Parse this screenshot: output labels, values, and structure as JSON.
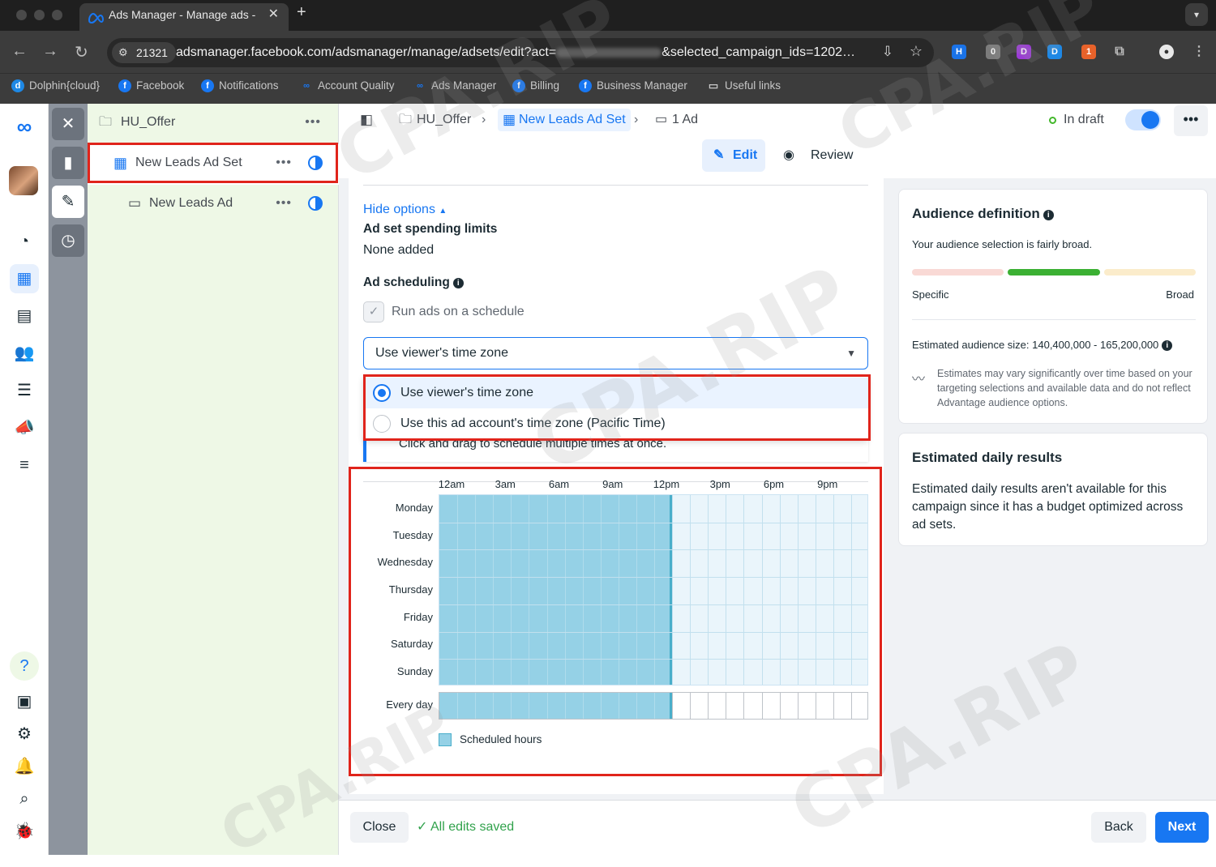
{
  "browser": {
    "tab_title": "Ads Manager - Manage ads -",
    "site_chip": "21321",
    "url_prefix": "adsmanager.facebook.com/adsmanager/manage/adsets/edit?act=",
    "url_suffix": "&selected_campaign_ids=1202…",
    "bookmarks": [
      "Dolphin{cloud}",
      "Facebook",
      "Notifications",
      "Account Quality",
      "Ads Manager",
      "Billing",
      "Business Manager",
      "Useful links"
    ],
    "ext_badges": [
      "0",
      "1"
    ]
  },
  "tree": {
    "campaign": "HU_Offer",
    "adset": "New Leads Ad Set",
    "ad": "New Leads Ad"
  },
  "header": {
    "crumbs": [
      "HU_Offer",
      "New Leads Ad Set",
      "1 Ad"
    ],
    "status": "In draft",
    "edit": "Edit",
    "review": "Review"
  },
  "form": {
    "hide_options": "Hide options",
    "spending_title": "Ad set spending limits",
    "spending_value": "None added",
    "scheduling_title": "Ad scheduling",
    "run_on_schedule": "Run ads on a schedule",
    "timezone_selected": "Use viewer's time zone",
    "timezone_options": [
      "Use viewer's time zone",
      "Use this ad account's time zone (Pacific Time)"
    ],
    "hint": "Click and drag to schedule multiple times at once."
  },
  "schedule": {
    "hour_labels": [
      "12am",
      "3am",
      "6am",
      "9am",
      "12pm",
      "3pm",
      "6pm",
      "9pm"
    ],
    "days": [
      "Monday",
      "Tuesday",
      "Wednesday",
      "Thursday",
      "Friday",
      "Saturday",
      "Sunday"
    ],
    "every_day": "Every day",
    "scheduled_hours_start": 0,
    "scheduled_hours_end": 13,
    "legend": "Scheduled hours",
    "colors": {
      "scheduled": "#95d1e6",
      "edge": "#49aeca"
    }
  },
  "audience": {
    "title": "Audience definition",
    "subtitle": "Your audience selection is fairly broad.",
    "specific": "Specific",
    "broad": "Broad",
    "size": "Estimated audience size: 140,400,000 - 165,200,000",
    "note": "Estimates may vary significantly over time based on your targeting selections and available data and do not reflect Advantage audience options."
  },
  "daily": {
    "title": "Estimated daily results",
    "text": "Estimated daily results aren't available for this campaign since it has a budget optimized across ad sets."
  },
  "footer": {
    "close": "Close",
    "saved": "All edits saved",
    "back": "Back",
    "next": "Next"
  },
  "watermark": "CPA.RIP",
  "accent": "#1877f2"
}
